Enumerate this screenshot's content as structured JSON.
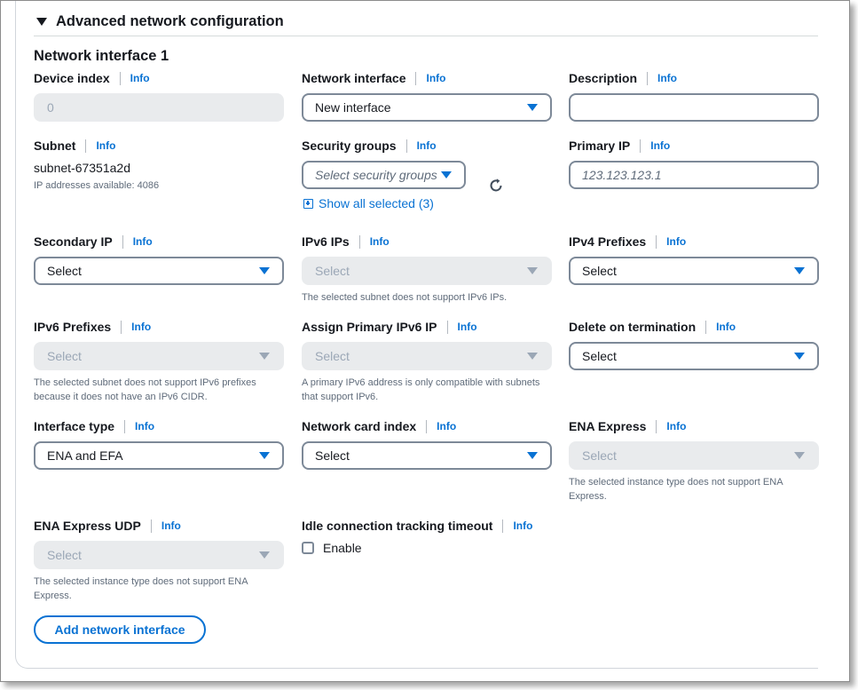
{
  "section": {
    "title": "Advanced network configuration"
  },
  "ni": {
    "title": "Network interface 1",
    "info": "Info",
    "device_index": {
      "label": "Device index",
      "value": "0"
    },
    "network_interface": {
      "label": "Network interface",
      "value": "New interface"
    },
    "description": {
      "label": "Description",
      "value": ""
    },
    "subnet": {
      "label": "Subnet",
      "value": "subnet-67351a2d",
      "help": "IP addresses available: 4086"
    },
    "security_groups": {
      "label": "Security groups",
      "placeholder": "Select security groups",
      "show_all": "Show all selected (3)"
    },
    "primary_ip": {
      "label": "Primary IP",
      "placeholder": "123.123.123.1"
    },
    "secondary_ip": {
      "label": "Secondary IP",
      "value": "Select"
    },
    "ipv6_ips": {
      "label": "IPv6 IPs",
      "value": "Select",
      "help": "The selected subnet does not support IPv6 IPs."
    },
    "ipv4_prefixes": {
      "label": "IPv4 Prefixes",
      "value": "Select"
    },
    "ipv6_prefixes": {
      "label": "IPv6 Prefixes",
      "value": "Select",
      "help": "The selected subnet does not support IPv6 prefixes because it does not have an IPv6 CIDR."
    },
    "assign_primary_ipv6": {
      "label": "Assign Primary IPv6 IP",
      "value": "Select",
      "help": "A primary IPv6 address is only compatible with subnets that support IPv6."
    },
    "delete_on_termination": {
      "label": "Delete on termination",
      "value": "Select"
    },
    "interface_type": {
      "label": "Interface type",
      "value": "ENA and EFA"
    },
    "network_card_index": {
      "label": "Network card index",
      "value": "Select"
    },
    "ena_express": {
      "label": "ENA Express",
      "value": "Select",
      "help": "The selected instance type does not support ENA Express."
    },
    "ena_express_udp": {
      "label": "ENA Express UDP",
      "value": "Select",
      "help": "The selected instance type does not support ENA Express."
    },
    "idle_timeout": {
      "label": "Idle connection tracking timeout",
      "checkbox_label": "Enable",
      "checked": false
    }
  },
  "add_button": {
    "label": "Add network interface"
  },
  "colors": {
    "link": "#0972d3",
    "text": "#16191f",
    "muted": "#5f6b7a",
    "disabled_bg": "#e9ebed"
  }
}
